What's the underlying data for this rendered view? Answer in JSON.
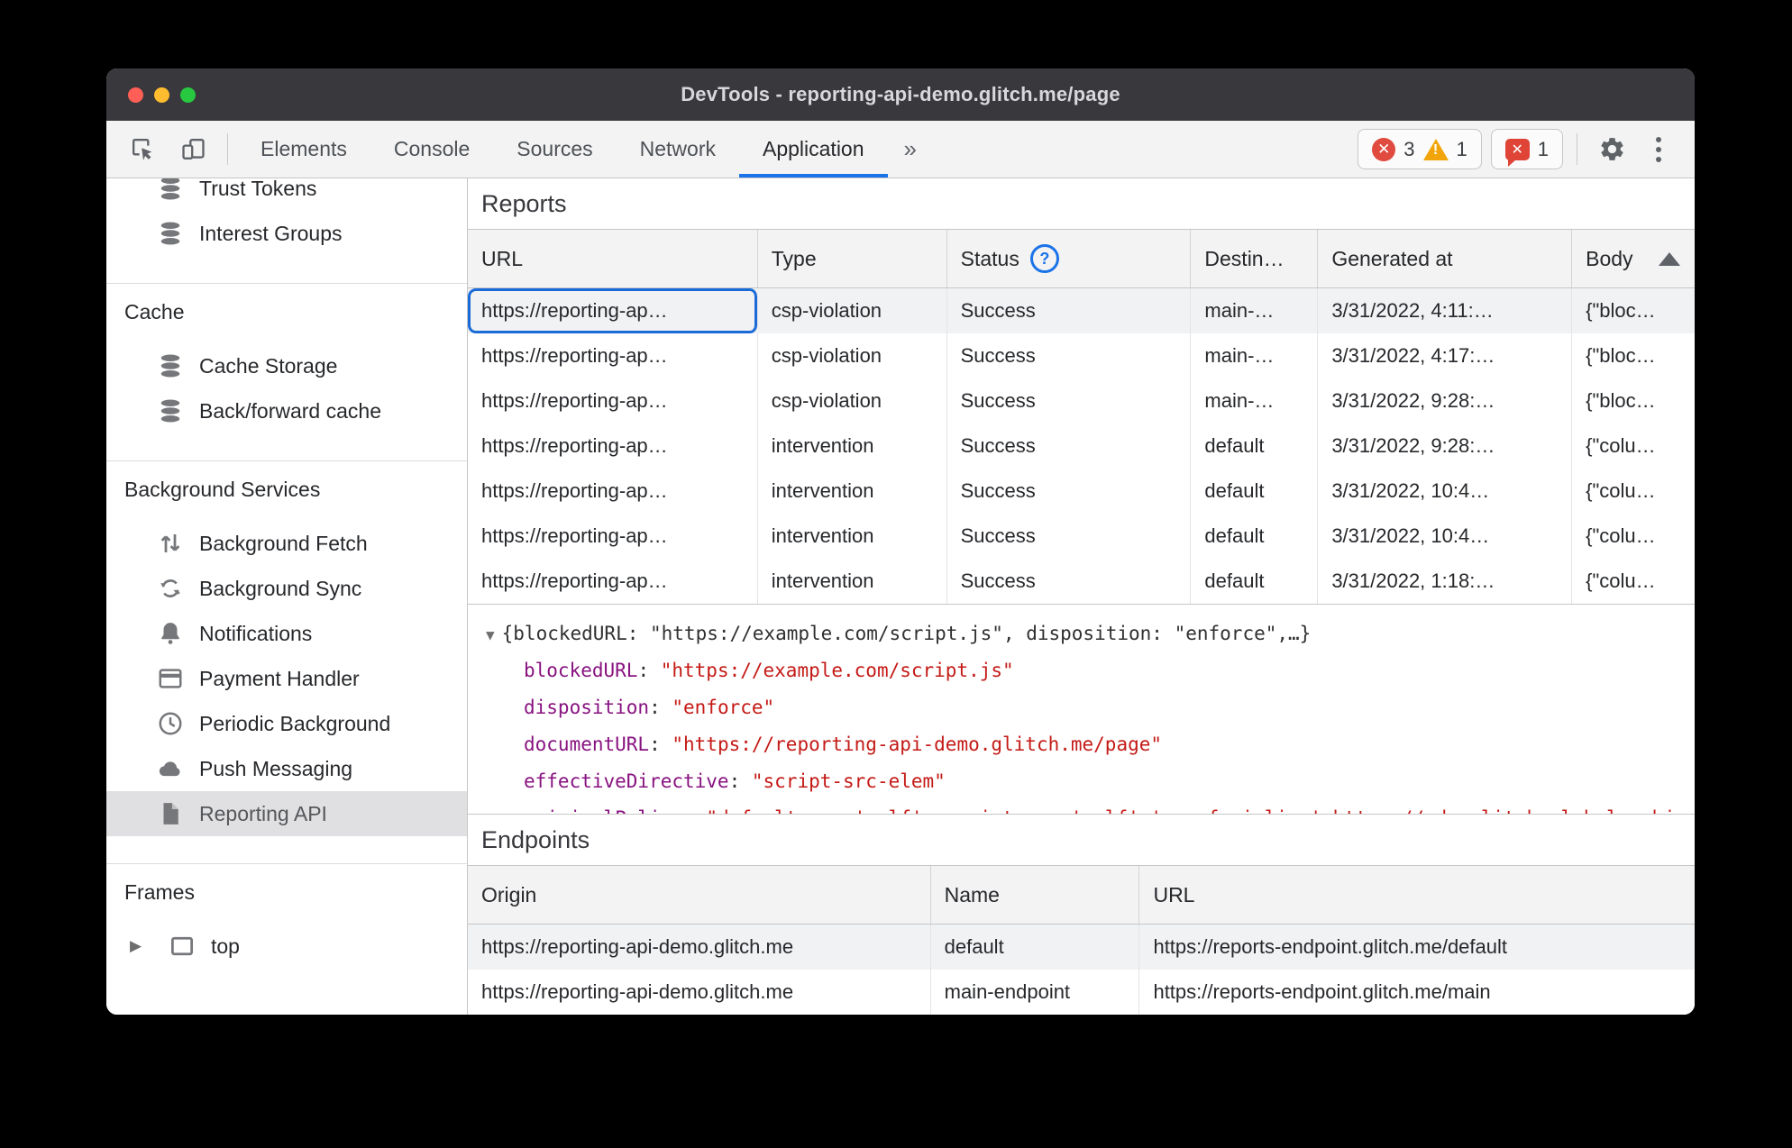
{
  "colors": {
    "accent_blue": "#1a73e8",
    "titlebar_bg": "#39383d",
    "toolbar_bg": "#f3f3f3",
    "error_red": "#e04a3f",
    "warning_yellow": "#f2a50a",
    "issue_red": "#df4437",
    "selected_row_bg": "#f0f2f4",
    "sidebar_selected_bg": "#e0e0e2",
    "json_key_purple": "#881280",
    "json_string_red": "#c41a16",
    "traffic_red": "#ff5f57",
    "traffic_yellow": "#febc2e",
    "traffic_green": "#28c840"
  },
  "window": {
    "title": "DevTools - reporting-api-demo.glitch.me/page"
  },
  "toolbar": {
    "tabs": [
      {
        "label": "Elements",
        "selected": false
      },
      {
        "label": "Console",
        "selected": false
      },
      {
        "label": "Sources",
        "selected": false
      },
      {
        "label": "Network",
        "selected": false
      },
      {
        "label": "Application",
        "selected": true
      }
    ],
    "more_tabs_glyph": "»",
    "badges": {
      "errors": "3",
      "warnings": "1",
      "issues": "1",
      "error_glyph": "✕",
      "issue_glyph": "✕"
    }
  },
  "sidebar": {
    "sections": [
      {
        "header": null,
        "items": [
          {
            "label": "Trust Tokens",
            "icon": "database",
            "clipped": true
          },
          {
            "label": "Interest Groups",
            "icon": "database"
          }
        ]
      },
      {
        "header": "Cache",
        "items": [
          {
            "label": "Cache Storage",
            "icon": "database"
          },
          {
            "label": "Back/forward cache",
            "icon": "database"
          }
        ]
      },
      {
        "header": "Background Services",
        "items": [
          {
            "label": "Background Fetch",
            "icon": "updown-arrows"
          },
          {
            "label": "Background Sync",
            "icon": "sync"
          },
          {
            "label": "Notifications",
            "icon": "bell"
          },
          {
            "label": "Payment Handler",
            "icon": "credit-card"
          },
          {
            "label": "Periodic Background",
            "icon": "clock"
          },
          {
            "label": "Push Messaging",
            "icon": "cloud"
          },
          {
            "label": "Reporting API",
            "icon": "document",
            "selected": true
          }
        ]
      },
      {
        "header": "Frames",
        "items": [
          {
            "label": "top",
            "icon": "frame",
            "expander": "▶"
          }
        ]
      }
    ]
  },
  "reports": {
    "title": "Reports",
    "columns": [
      {
        "label": "URL"
      },
      {
        "label": "Type"
      },
      {
        "label": "Status",
        "help": true,
        "help_glyph": "?"
      },
      {
        "label": "Destin…"
      },
      {
        "label": "Generated at"
      },
      {
        "label": "Body",
        "sort": "asc"
      }
    ],
    "rows": [
      [
        "https://reporting-ap…",
        "csp-violation",
        "Success",
        "main-…",
        "3/31/2022, 4:11:…",
        "{\"bloc…"
      ],
      [
        "https://reporting-ap…",
        "csp-violation",
        "Success",
        "main-…",
        "3/31/2022, 4:17:…",
        "{\"bloc…"
      ],
      [
        "https://reporting-ap…",
        "csp-violation",
        "Success",
        "main-…",
        "3/31/2022, 9:28:…",
        "{\"bloc…"
      ],
      [
        "https://reporting-ap…",
        "intervention",
        "Success",
        "default",
        "3/31/2022, 9:28:…",
        "{\"colu…"
      ],
      [
        "https://reporting-ap…",
        "intervention",
        "Success",
        "default",
        "3/31/2022, 10:4…",
        "{\"colu…"
      ],
      [
        "https://reporting-ap…",
        "intervention",
        "Success",
        "default",
        "3/31/2022, 10:4…",
        "{\"colu…"
      ],
      [
        "https://reporting-ap…",
        "intervention",
        "Success",
        "default",
        "3/31/2022, 1:18:…",
        "{\"colu…"
      ]
    ],
    "selected_row_index": 0
  },
  "detail": {
    "expander_glyph": "▼",
    "preview": "{blockedURL: \"https://example.com/script.js\", disposition: \"enforce\",…}",
    "fields": [
      {
        "key": "blockedURL",
        "value": "\"https://example.com/script.js\""
      },
      {
        "key": "disposition",
        "value": "\"enforce\""
      },
      {
        "key": "documentURL",
        "value": "\"https://reporting-api-demo.glitch.me/page\""
      },
      {
        "key": "effectiveDirective",
        "value": "\"script-src-elem\""
      },
      {
        "key": "originalPolicy",
        "value": "\"default-src 'self'; script-src 'self' 'unsafe-inline' https://cdn.glitch.global; object-src 'none'\""
      }
    ]
  },
  "endpoints": {
    "title": "Endpoints",
    "columns": [
      {
        "label": "Origin"
      },
      {
        "label": "Name"
      },
      {
        "label": "URL"
      }
    ],
    "rows": [
      [
        "https://reporting-api-demo.glitch.me",
        "default",
        "https://reports-endpoint.glitch.me/default"
      ],
      [
        "https://reporting-api-demo.glitch.me",
        "main-endpoint",
        "https://reports-endpoint.glitch.me/main"
      ]
    ]
  }
}
